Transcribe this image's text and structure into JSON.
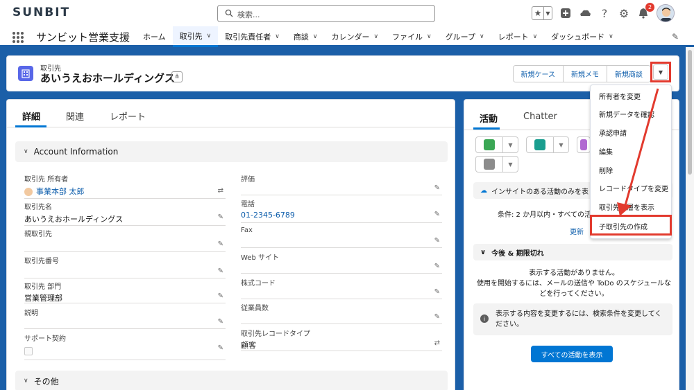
{
  "header": {
    "logo": "SUNBIT",
    "search_placeholder": "検索...",
    "notification_count": "2"
  },
  "nav": {
    "app_name": "サンビット営業支援",
    "items": [
      {
        "label": "ホーム",
        "chevron": false,
        "active": false
      },
      {
        "label": "取引先",
        "chevron": true,
        "active": true
      },
      {
        "label": "取引先責任者",
        "chevron": true,
        "active": false
      },
      {
        "label": "商談",
        "chevron": true,
        "active": false
      },
      {
        "label": "カレンダー",
        "chevron": true,
        "active": false
      },
      {
        "label": "ファイル",
        "chevron": true,
        "active": false
      },
      {
        "label": "グループ",
        "chevron": true,
        "active": false
      },
      {
        "label": "レポート",
        "chevron": true,
        "active": false
      },
      {
        "label": "ダッシュボード",
        "chevron": true,
        "active": false
      }
    ]
  },
  "record": {
    "type_label": "取引先",
    "title": "あいうえおホールディングス",
    "buttons": [
      "新規ケース",
      "新規メモ",
      "新規商談"
    ]
  },
  "left": {
    "tabs": [
      "詳細",
      "関連",
      "レポート"
    ],
    "section1": "Account Information",
    "section2": "その他",
    "fields_left": [
      {
        "label": "取引先 所有者",
        "value": "事業本部 太郎"
      },
      {
        "label": "取引先名",
        "value": "あいうえおホールディングス"
      },
      {
        "label": "親取引先",
        "value": ""
      },
      {
        "label": "取引先番号",
        "value": ""
      },
      {
        "label": "取引先 部門",
        "value": "営業管理部"
      },
      {
        "label": "説明",
        "value": ""
      },
      {
        "label": "サポート契約",
        "value": ""
      }
    ],
    "fields_right": [
      {
        "label": "評価",
        "value": ""
      },
      {
        "label": "電話",
        "value": "01-2345-6789"
      },
      {
        "label": "Fax",
        "value": ""
      },
      {
        "label": "Web サイト",
        "value": ""
      },
      {
        "label": "株式コード",
        "value": ""
      },
      {
        "label": "従業員数",
        "value": ""
      },
      {
        "label": "取引先レコードタイプ",
        "value": "顧客"
      }
    ]
  },
  "right": {
    "tabs": [
      "活動",
      "Chatter"
    ],
    "insight": "インサイトのある活動のみを表",
    "condition": "条件: 2 か月以内・すべての活",
    "update": "更新",
    "section": "今後 & 期限切れ",
    "empty_msg": "表示する活動がありません。",
    "empty_sub": "使用を開始するには、メールの送信や ToDo のスケジュールなどを行ってください。",
    "info": "表示する内容を変更するには、検索条件を変更してください。",
    "all_button": "すべての活動を表示"
  },
  "menu": {
    "items": [
      "所有者を変更",
      "新規データを確認",
      "承認申請",
      "編集",
      "削除",
      "レコードタイプを変更",
      "取引先階層を表示",
      "子取引先の作成"
    ]
  },
  "colors": {
    "brand_blue": "#0176d3",
    "highlight_red": "#e23a2e",
    "account_icon": "#5867e8"
  }
}
